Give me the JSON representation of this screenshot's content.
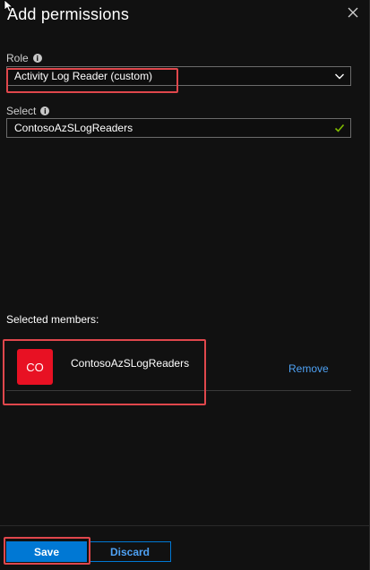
{
  "header": {
    "title": "Add permissions"
  },
  "icons": {
    "cursor": "mouse-pointer-icon",
    "close": "close-icon",
    "info": "info-icon",
    "chevron": "chevron-down-icon",
    "check": "checkmark-icon"
  },
  "role": {
    "label": "Role",
    "info_glyph": "i",
    "value": "Activity Log Reader (custom)"
  },
  "select": {
    "label": "Select",
    "info_glyph": "i",
    "value": "ContosoAzSLogReaders"
  },
  "members": {
    "heading": "Selected members:",
    "items": [
      {
        "avatar_initials": "CO",
        "name": "ContosoAzSLogReaders",
        "remove_label": "Remove"
      }
    ]
  },
  "footer": {
    "save_label": "Save",
    "discard_label": "Discard"
  },
  "colors": {
    "background": "#111111",
    "accent": "#0078d4",
    "link": "#4ea1f3",
    "avatar": "#e81123",
    "highlight": "#e0474c",
    "check": "#7fba00"
  }
}
